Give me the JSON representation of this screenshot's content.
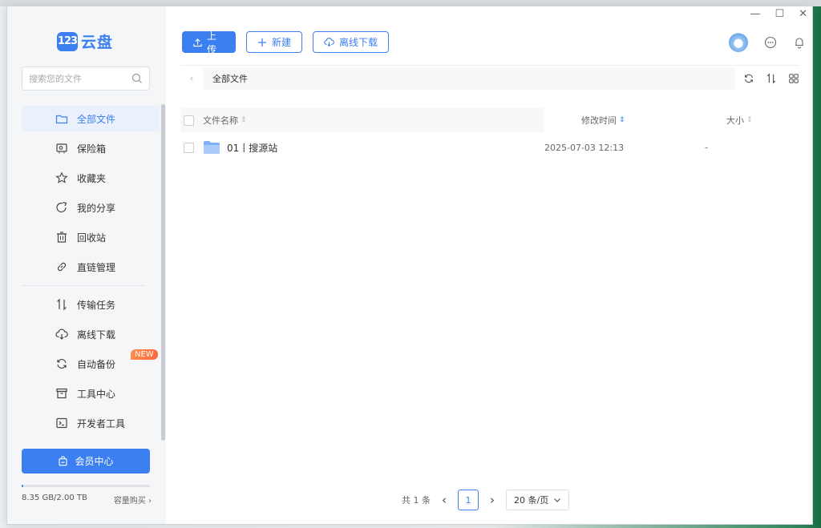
{
  "app": {
    "logo_badge": "123",
    "logo_text": "云盘"
  },
  "search": {
    "placeholder": "搜索您的文件"
  },
  "sidebar": {
    "items": [
      {
        "label": "全部文件",
        "icon": "folder-icon",
        "active": true
      },
      {
        "label": "保险箱",
        "icon": "safe-icon"
      },
      {
        "label": "收藏夹",
        "icon": "star-icon"
      },
      {
        "label": "我的分享",
        "icon": "share-icon"
      },
      {
        "label": "回收站",
        "icon": "trash-icon"
      },
      {
        "label": "直链管理",
        "icon": "link-icon"
      },
      {
        "label": "传输任务",
        "icon": "transfer-icon"
      },
      {
        "label": "离线下载",
        "icon": "cloud-download-icon"
      },
      {
        "label": "自动备份",
        "icon": "sync-icon",
        "badge": "NEW"
      },
      {
        "label": "工具中心",
        "icon": "toolbox-icon"
      },
      {
        "label": "开发者工具",
        "icon": "terminal-icon"
      }
    ],
    "vip_label": "会员中心",
    "quota_text": "8.35 GB/2.00 TB",
    "quota_fraction": 0.004,
    "buy_label": "容量购买 ›"
  },
  "toolbar": {
    "upload_label": "上传",
    "new_label": "新建",
    "offline_label": "离线下载"
  },
  "breadcrumb": {
    "path": "全部文件"
  },
  "table": {
    "headers": {
      "name": "文件名称",
      "modified": "修改时间",
      "size": "大小"
    },
    "rows": [
      {
        "name": "01丨搜源站",
        "modified": "2025-07-03 12:13",
        "size": "-"
      }
    ]
  },
  "pager": {
    "total": "共 1 条",
    "page": "1",
    "page_size": "20 条/页"
  },
  "colors": {
    "accent": "#3b7ff0",
    "badge": "#ff6a3c"
  }
}
